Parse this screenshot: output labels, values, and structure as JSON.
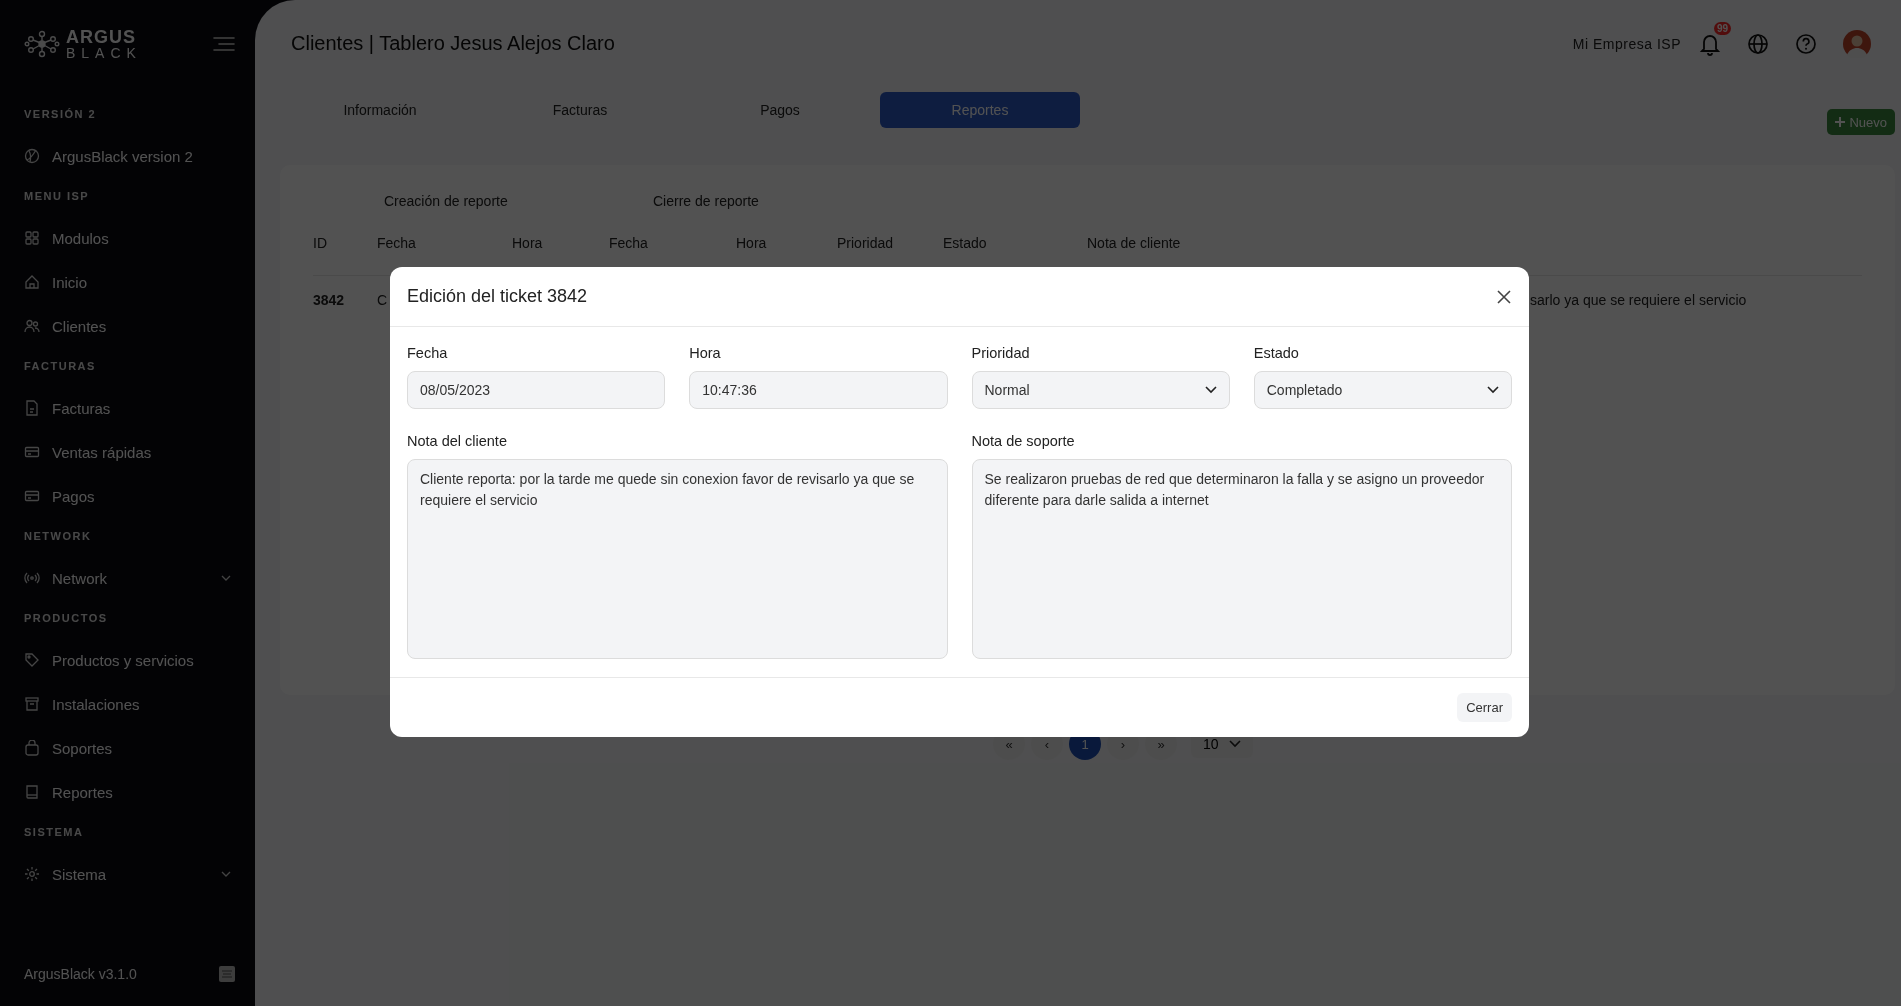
{
  "sidebar": {
    "logo": {
      "line_1": "ARGUS",
      "line_2": "BLACK"
    },
    "sections": [
      {
        "heading": "VERSIÓN 2",
        "items": [
          {
            "label": "ArgusBlack version 2",
            "kind": "ball",
            "expandable": false
          }
        ]
      },
      {
        "heading": "MENU ISP",
        "items": [
          {
            "label": "Modulos",
            "kind": "grid",
            "expandable": false
          },
          {
            "label": "Inicio",
            "kind": "home",
            "expandable": false
          },
          {
            "label": "Clientes",
            "kind": "users",
            "expandable": false
          }
        ]
      },
      {
        "heading": "FACTURAS",
        "items": [
          {
            "label": "Facturas",
            "kind": "file",
            "expandable": false
          },
          {
            "label": "Ventas rápidas",
            "kind": "card",
            "expandable": false
          },
          {
            "label": "Pagos",
            "kind": "card",
            "expandable": false
          }
        ]
      },
      {
        "heading": "NETWORK",
        "items": [
          {
            "label": "Network",
            "kind": "signal",
            "expandable": true
          }
        ]
      },
      {
        "heading": "PRODUCTOS",
        "items": [
          {
            "label": "Productos y servicios",
            "kind": "tag",
            "expandable": false
          },
          {
            "label": "Instalaciones",
            "kind": "archive",
            "expandable": false
          },
          {
            "label": "Soportes",
            "kind": "bag",
            "expandable": false
          },
          {
            "label": "Reportes",
            "kind": "book",
            "expandable": false
          }
        ]
      },
      {
        "heading": "SISTEMA",
        "items": [
          {
            "label": "Sistema",
            "kind": "gear",
            "expandable": true
          }
        ]
      }
    ],
    "footer": "ArgusBlack v3.1.0"
  },
  "header": {
    "title": "Clientes | Tablero Jesus Alejos Claro",
    "company": "Mi Empresa ISP",
    "notification_count": "99"
  },
  "tabs": [
    {
      "label": "Información",
      "selected": false
    },
    {
      "label": "Facturas",
      "selected": false
    },
    {
      "label": "Pagos",
      "selected": false
    },
    {
      "label": "Reportes",
      "selected": true
    }
  ],
  "new_button": "Nuevo",
  "table": {
    "groups": [
      "Creación de reporte",
      "Cierre de reporte"
    ],
    "columns": [
      "ID",
      "Fecha",
      "Hora",
      "Fecha",
      "Hora",
      "Prioridad",
      "Estado",
      "Nota de cliente"
    ],
    "rows": [
      {
        "id": "3842",
        "fecha": "C",
        "nota_de_cliente": "sarlo ya que se requiere el servicio"
      }
    ]
  },
  "pagination": {
    "pages": [
      {
        "label": "«",
        "selected": false
      },
      {
        "label": "‹",
        "selected": false
      },
      {
        "label": "1",
        "selected": true
      },
      {
        "label": "›",
        "selected": false
      },
      {
        "label": "»",
        "selected": false
      }
    ],
    "page_size": "10"
  },
  "modal": {
    "title": "Edición del ticket 3842",
    "fields": [
      {
        "label": "Fecha",
        "value": "08/05/2023",
        "kind": "text"
      },
      {
        "label": "Hora",
        "value": "10:47:36",
        "kind": "text"
      },
      {
        "label": "Prioridad",
        "value": "Normal",
        "kind": "select"
      },
      {
        "label": "Estado",
        "value": "Completado",
        "kind": "select"
      }
    ],
    "notes": [
      {
        "label": "Nota del cliente",
        "value": "Cliente reporta: por la tarde me quede sin conexion favor de revisarlo ya que se requiere el servicio"
      },
      {
        "label": "Nota de soporte",
        "value": "Se realizaron pruebas de red que determinaron la falla y se asigno un proveedor diferente para darle salida a internet"
      }
    ],
    "close_button": "Cerrar"
  }
}
